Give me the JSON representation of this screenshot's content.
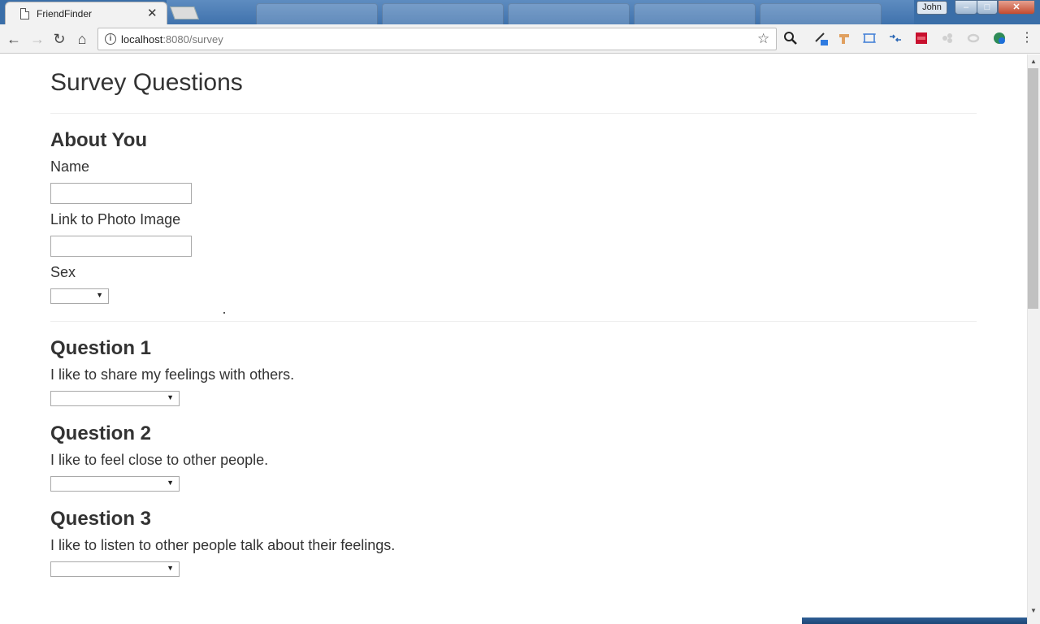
{
  "browser": {
    "tab": {
      "title": "FriendFinder"
    },
    "user_badge": "John",
    "window_controls": {
      "minimize": "‒",
      "maximize": "□",
      "close": "✕"
    },
    "nav": {
      "back": "←",
      "forward": "→",
      "reload": "↻",
      "home": "⌂"
    },
    "address": {
      "host": "localhost",
      "port_path": ":8080/survey",
      "info": "i"
    },
    "menu": "⋮"
  },
  "page": {
    "title": "Survey Questions",
    "about": {
      "heading": "About You",
      "name_label": "Name",
      "name_value": "",
      "photo_label": "Link to Photo Image",
      "photo_value": "",
      "sex_label": "Sex",
      "sex_selected": ""
    },
    "questions": [
      {
        "heading": "Question 1",
        "text": "I like to share my feelings with others.",
        "selected": ""
      },
      {
        "heading": "Question 2",
        "text": "I like to feel close to other people.",
        "selected": ""
      },
      {
        "heading": "Question 3",
        "text": "I like to listen to other people talk about their feelings.",
        "selected": ""
      }
    ]
  }
}
